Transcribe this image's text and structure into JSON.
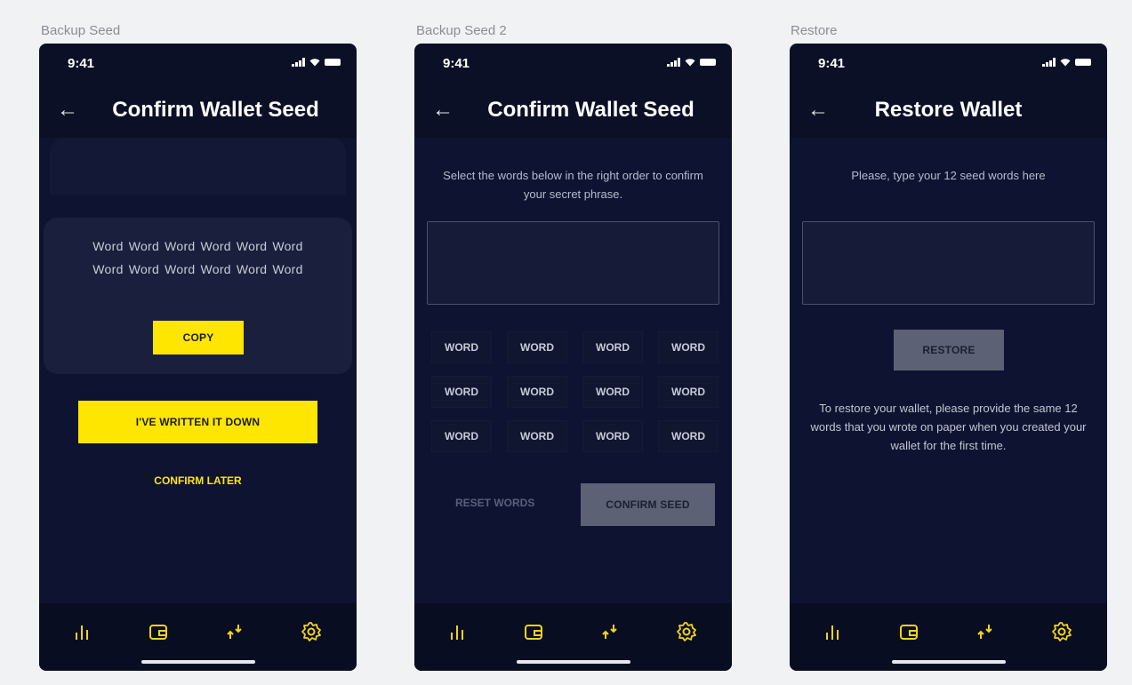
{
  "frames": [
    {
      "label": "Backup Seed",
      "status_time": "9:41",
      "title": "Confirm Wallet Seed",
      "words_row1": [
        "Word",
        "Word",
        "Word",
        "Word",
        "Word",
        "Word"
      ],
      "words_row2": [
        "Word",
        "Word",
        "Word",
        "Word",
        "Word",
        "Word"
      ],
      "copy_label": "COPY",
      "written_label": "I'VE WRITTEN IT DOWN",
      "confirm_later_label": "CONFIRM LATER"
    },
    {
      "label": "Backup Seed 2",
      "status_time": "9:41",
      "title": "Confirm Wallet Seed",
      "instruction": "Select the words below in the right order to confirm your secret phrase.",
      "words": [
        "WORD",
        "WORD",
        "WORD",
        "WORD",
        "WORD",
        "WORD",
        "WORD",
        "WORD",
        "WORD",
        "WORD",
        "WORD",
        "WORD"
      ],
      "reset_label": "RESET WORDS",
      "confirm_label": "CONFIRM SEED"
    },
    {
      "label": "Restore",
      "status_time": "9:41",
      "title": "Restore Wallet",
      "instruction": "Please, type your 12 seed words here",
      "restore_label": "RESTORE",
      "body": "To restore your wallet, please provide the same 12 words that you wrote on paper when you created your wallet for the first time."
    }
  ],
  "tabbar_icons": [
    "stats-icon",
    "wallet-icon",
    "transfer-icon",
    "settings-icon"
  ],
  "colors": {
    "accent": "#ffe600",
    "background": "#0b1026",
    "muted_button": "#5c6175"
  }
}
